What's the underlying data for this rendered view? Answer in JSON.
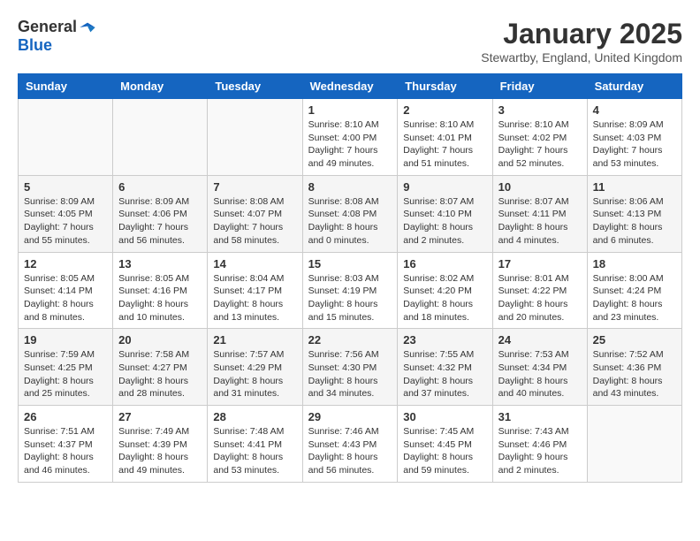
{
  "header": {
    "logo_general": "General",
    "logo_blue": "Blue",
    "title": "January 2025",
    "location": "Stewartby, England, United Kingdom"
  },
  "days_of_week": [
    "Sunday",
    "Monday",
    "Tuesday",
    "Wednesday",
    "Thursday",
    "Friday",
    "Saturday"
  ],
  "weeks": [
    [
      {
        "day": "",
        "info": ""
      },
      {
        "day": "",
        "info": ""
      },
      {
        "day": "",
        "info": ""
      },
      {
        "day": "1",
        "info": "Sunrise: 8:10 AM\nSunset: 4:00 PM\nDaylight: 7 hours\nand 49 minutes."
      },
      {
        "day": "2",
        "info": "Sunrise: 8:10 AM\nSunset: 4:01 PM\nDaylight: 7 hours\nand 51 minutes."
      },
      {
        "day": "3",
        "info": "Sunrise: 8:10 AM\nSunset: 4:02 PM\nDaylight: 7 hours\nand 52 minutes."
      },
      {
        "day": "4",
        "info": "Sunrise: 8:09 AM\nSunset: 4:03 PM\nDaylight: 7 hours\nand 53 minutes."
      }
    ],
    [
      {
        "day": "5",
        "info": "Sunrise: 8:09 AM\nSunset: 4:05 PM\nDaylight: 7 hours\nand 55 minutes."
      },
      {
        "day": "6",
        "info": "Sunrise: 8:09 AM\nSunset: 4:06 PM\nDaylight: 7 hours\nand 56 minutes."
      },
      {
        "day": "7",
        "info": "Sunrise: 8:08 AM\nSunset: 4:07 PM\nDaylight: 7 hours\nand 58 minutes."
      },
      {
        "day": "8",
        "info": "Sunrise: 8:08 AM\nSunset: 4:08 PM\nDaylight: 8 hours\nand 0 minutes."
      },
      {
        "day": "9",
        "info": "Sunrise: 8:07 AM\nSunset: 4:10 PM\nDaylight: 8 hours\nand 2 minutes."
      },
      {
        "day": "10",
        "info": "Sunrise: 8:07 AM\nSunset: 4:11 PM\nDaylight: 8 hours\nand 4 minutes."
      },
      {
        "day": "11",
        "info": "Sunrise: 8:06 AM\nSunset: 4:13 PM\nDaylight: 8 hours\nand 6 minutes."
      }
    ],
    [
      {
        "day": "12",
        "info": "Sunrise: 8:05 AM\nSunset: 4:14 PM\nDaylight: 8 hours\nand 8 minutes."
      },
      {
        "day": "13",
        "info": "Sunrise: 8:05 AM\nSunset: 4:16 PM\nDaylight: 8 hours\nand 10 minutes."
      },
      {
        "day": "14",
        "info": "Sunrise: 8:04 AM\nSunset: 4:17 PM\nDaylight: 8 hours\nand 13 minutes."
      },
      {
        "day": "15",
        "info": "Sunrise: 8:03 AM\nSunset: 4:19 PM\nDaylight: 8 hours\nand 15 minutes."
      },
      {
        "day": "16",
        "info": "Sunrise: 8:02 AM\nSunset: 4:20 PM\nDaylight: 8 hours\nand 18 minutes."
      },
      {
        "day": "17",
        "info": "Sunrise: 8:01 AM\nSunset: 4:22 PM\nDaylight: 8 hours\nand 20 minutes."
      },
      {
        "day": "18",
        "info": "Sunrise: 8:00 AM\nSunset: 4:24 PM\nDaylight: 8 hours\nand 23 minutes."
      }
    ],
    [
      {
        "day": "19",
        "info": "Sunrise: 7:59 AM\nSunset: 4:25 PM\nDaylight: 8 hours\nand 25 minutes."
      },
      {
        "day": "20",
        "info": "Sunrise: 7:58 AM\nSunset: 4:27 PM\nDaylight: 8 hours\nand 28 minutes."
      },
      {
        "day": "21",
        "info": "Sunrise: 7:57 AM\nSunset: 4:29 PM\nDaylight: 8 hours\nand 31 minutes."
      },
      {
        "day": "22",
        "info": "Sunrise: 7:56 AM\nSunset: 4:30 PM\nDaylight: 8 hours\nand 34 minutes."
      },
      {
        "day": "23",
        "info": "Sunrise: 7:55 AM\nSunset: 4:32 PM\nDaylight: 8 hours\nand 37 minutes."
      },
      {
        "day": "24",
        "info": "Sunrise: 7:53 AM\nSunset: 4:34 PM\nDaylight: 8 hours\nand 40 minutes."
      },
      {
        "day": "25",
        "info": "Sunrise: 7:52 AM\nSunset: 4:36 PM\nDaylight: 8 hours\nand 43 minutes."
      }
    ],
    [
      {
        "day": "26",
        "info": "Sunrise: 7:51 AM\nSunset: 4:37 PM\nDaylight: 8 hours\nand 46 minutes."
      },
      {
        "day": "27",
        "info": "Sunrise: 7:49 AM\nSunset: 4:39 PM\nDaylight: 8 hours\nand 49 minutes."
      },
      {
        "day": "28",
        "info": "Sunrise: 7:48 AM\nSunset: 4:41 PM\nDaylight: 8 hours\nand 53 minutes."
      },
      {
        "day": "29",
        "info": "Sunrise: 7:46 AM\nSunset: 4:43 PM\nDaylight: 8 hours\nand 56 minutes."
      },
      {
        "day": "30",
        "info": "Sunrise: 7:45 AM\nSunset: 4:45 PM\nDaylight: 8 hours\nand 59 minutes."
      },
      {
        "day": "31",
        "info": "Sunrise: 7:43 AM\nSunset: 4:46 PM\nDaylight: 9 hours\nand 2 minutes."
      },
      {
        "day": "",
        "info": ""
      }
    ]
  ]
}
